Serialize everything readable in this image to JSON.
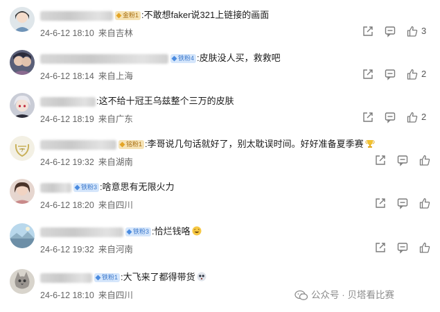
{
  "comments": [
    {
      "badge": "金粉1",
      "badge_style": "gold",
      "text": "不敢想faker说321上链接的画面",
      "date": "24-6-12 18:10",
      "location": "来自吉林",
      "likes": "3",
      "has_emoji": false
    },
    {
      "badge": "铁粉4",
      "badge_style": "blue",
      "text": "皮肤没人买，救救吧",
      "date": "24-6-12 18:14",
      "location": "来自上海",
      "likes": "2",
      "has_emoji": false
    },
    {
      "badge": "",
      "badge_style": "",
      "text": "这不给十冠王乌兹整个三万的皮肤",
      "date": "24-6-12 18:19",
      "location": "来自广东",
      "likes": "2",
      "has_emoji": false
    },
    {
      "badge": "铭粉1",
      "badge_style": "gold",
      "text": "李哥说几句话就好了，别太耽误时间。好好准备夏季赛",
      "date": "24-6-12 19:32",
      "location": "来自湖南",
      "likes": "",
      "has_emoji": true
    },
    {
      "badge": "铁粉3",
      "badge_style": "blue",
      "text": "啥意思有无限火力",
      "date": "24-6-12 18:20",
      "location": "来自四川",
      "likes": "",
      "has_emoji": false
    },
    {
      "badge": "铁粉3",
      "badge_style": "blue",
      "text": "恰烂钱咯",
      "date": "24-6-12 19:32",
      "location": "来自河南",
      "likes": "",
      "has_emoji": true
    },
    {
      "badge": "铁粉1",
      "badge_style": "blue",
      "text": "大飞来了都得带货",
      "date": "24-6-12 18:10",
      "location": "来自四川",
      "likes": "",
      "has_emoji": true
    }
  ],
  "watermark": {
    "text": "公众号 · 贝塔看比赛"
  },
  "colors": {
    "text": "#1a1a1a",
    "meta": "#666666",
    "icon": "#7a7a7a",
    "badge_gold": "#f6e3b5",
    "badge_blue": "#d5e6fb"
  }
}
